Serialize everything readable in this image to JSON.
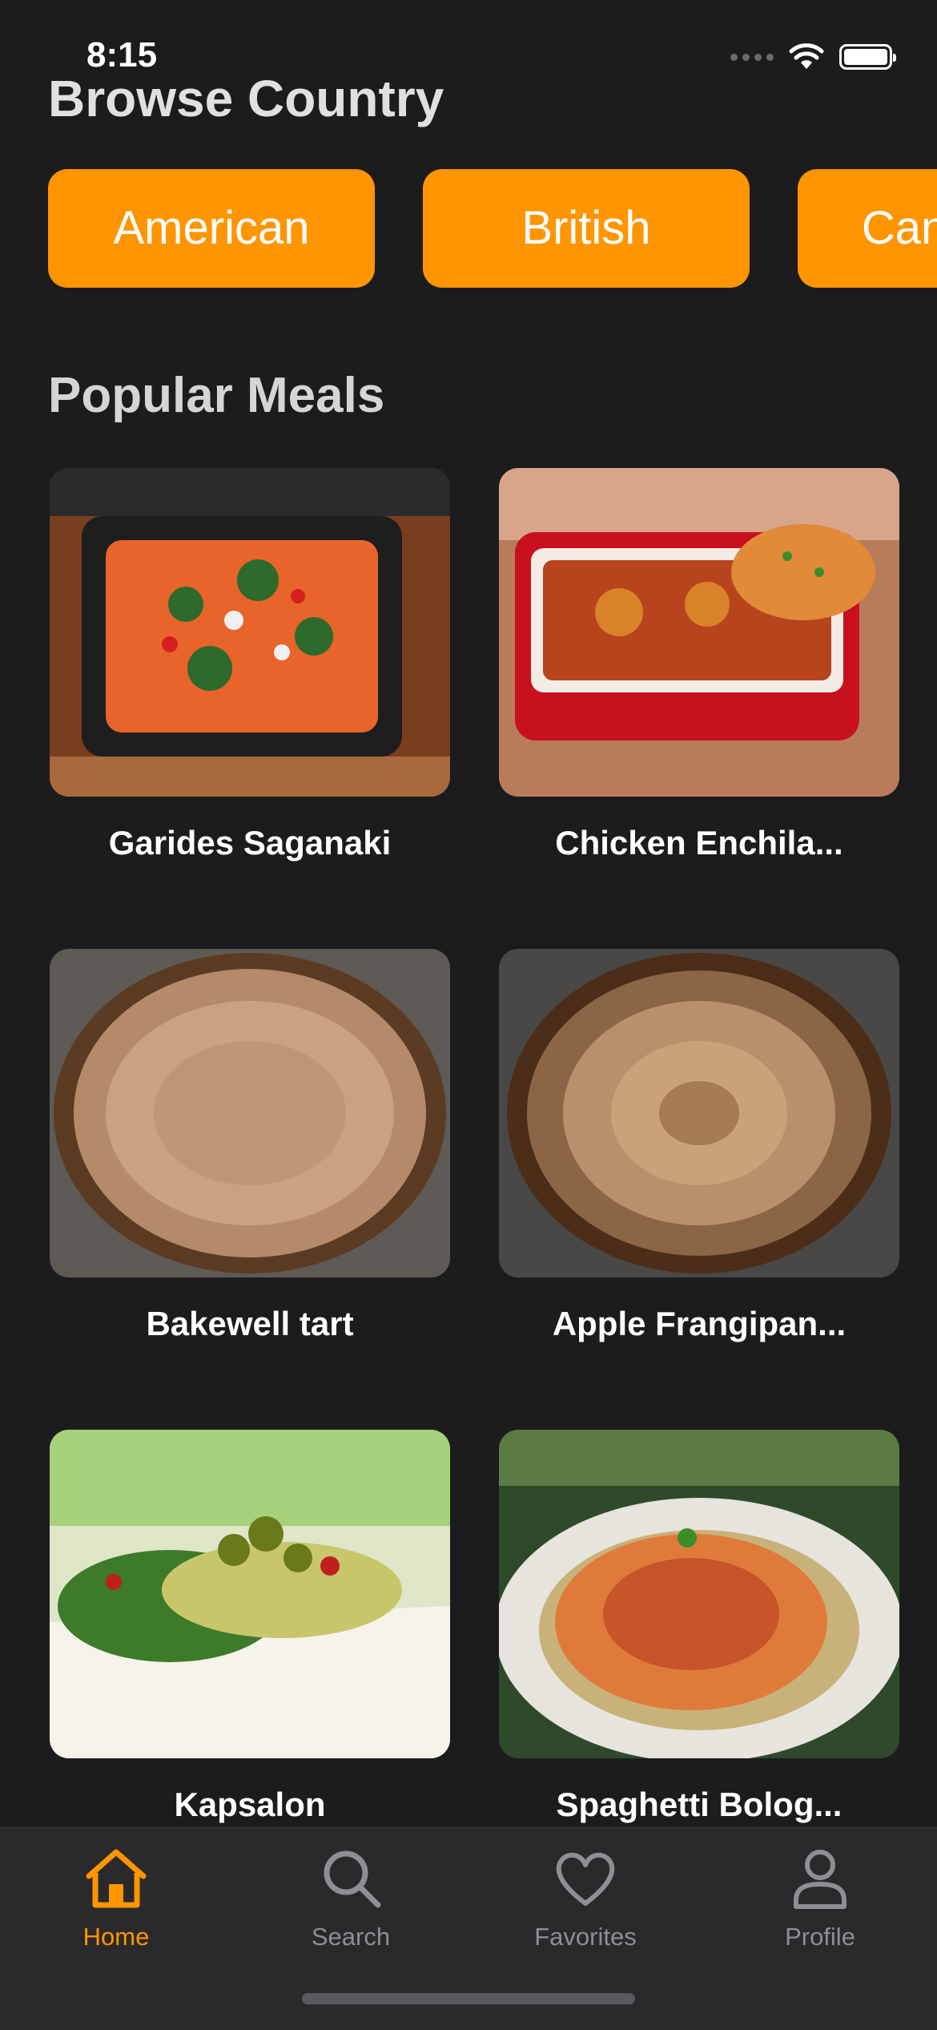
{
  "status": {
    "time": "8:15"
  },
  "header": {
    "title": "Browse Country"
  },
  "countries": [
    "American",
    "British",
    "Canadian"
  ],
  "section": {
    "title": "Popular Meals"
  },
  "meals": [
    {
      "name": "Garides Saganaki"
    },
    {
      "name": "Chicken Enchila..."
    },
    {
      "name": "Bakewell tart"
    },
    {
      "name": "Apple Frangipan..."
    },
    {
      "name": "Kapsalon"
    },
    {
      "name": "Spaghetti Bolog..."
    }
  ],
  "tabs": [
    {
      "label": "Home",
      "icon": "house-icon"
    },
    {
      "label": "Search",
      "icon": "magnifier-icon"
    },
    {
      "label": "Favorites",
      "icon": "heart-icon"
    },
    {
      "label": "Profile",
      "icon": "person-icon"
    }
  ],
  "colors": {
    "accent": "#ff9500",
    "background": "#1c1c1e",
    "tabbar": "#2a2a2c"
  }
}
